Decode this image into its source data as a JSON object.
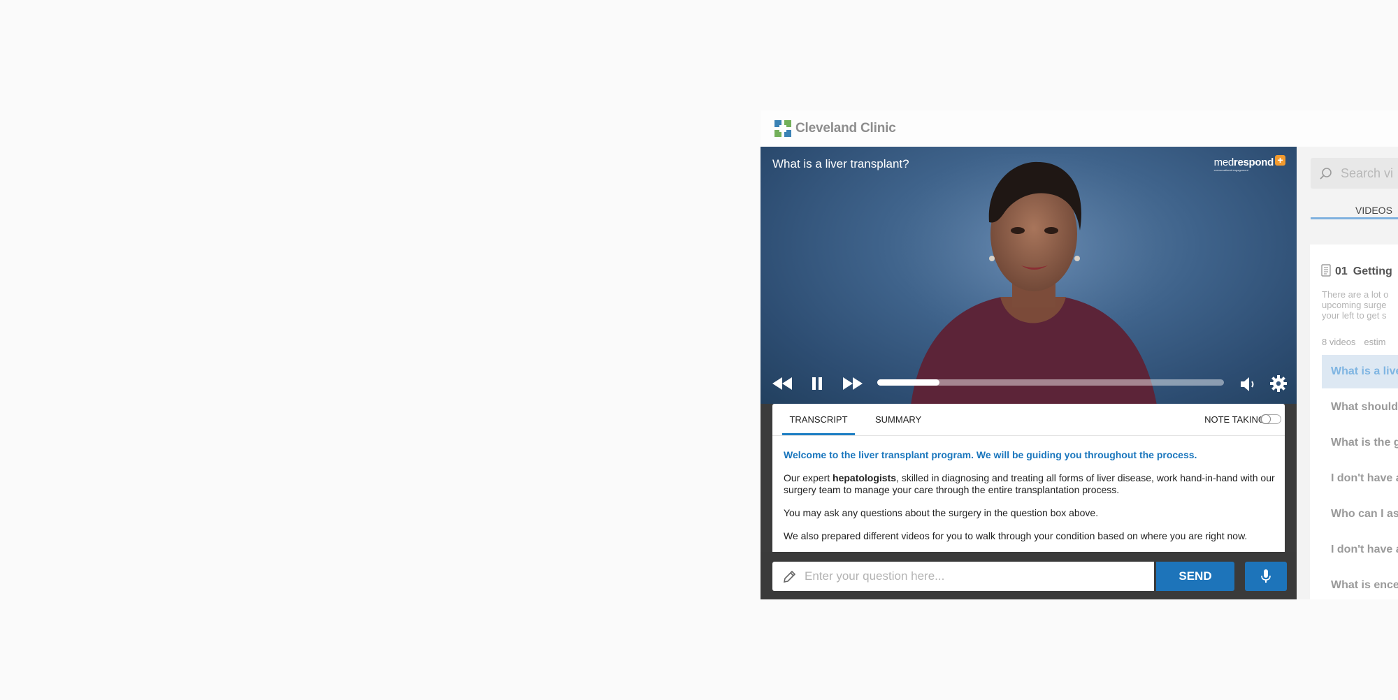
{
  "header": {
    "brand": "Cleveland Clinic"
  },
  "player": {
    "title": "What is a liver transplant?",
    "watermark_prefix": "med",
    "watermark_suffix": "respond",
    "watermark_sub": "conversational engagement",
    "progress_fraction": 0.18
  },
  "transcript_panel": {
    "tabs": [
      "TRANSCRIPT",
      "SUMMARY"
    ],
    "active_tab": "TRANSCRIPT",
    "note_taking_label": "NOTE TAKING",
    "note_taking_on": false,
    "lead": "Welcome to the liver transplant program. We will be guiding you throughout the process.",
    "p1_before": "Our expert ",
    "p1_bold": "hepatologists",
    "p1_after": ", skilled in diagnosing and treating all forms of liver disease, work hand-in-hand with our surgery team to manage your care through the entire transplantation process.",
    "p2": "You may ask any questions about the surgery in the question box above.",
    "p3": "We also prepared different videos for you to walk through your condition based on where you are right now."
  },
  "question": {
    "placeholder": "Enter your question here...",
    "value": "",
    "send_label": "SEND"
  },
  "sidebar": {
    "search_placeholder": "Search vi",
    "tab_label": "VIDEOS",
    "section_number": "01",
    "section_title": "Getting",
    "description_lines": [
      "There are a lot o",
      "upcoming surge",
      "your left to get s"
    ],
    "video_count": "8 videos",
    "estimate_label": "estim",
    "videos": [
      "What is a live",
      "What should",
      "What is the g",
      "I don't have a",
      "Who can I as",
      "I don't have a",
      "What is ence"
    ]
  },
  "colors": {
    "accent": "#1d74ba",
    "active_item_bg": "#dde8f3",
    "active_item_text": "#7fb5e2",
    "lead_text": "#1a76bd"
  },
  "icons": [
    "cleveland-logo-icon",
    "rewind-icon",
    "pause-icon",
    "fast-forward-icon",
    "volume-icon",
    "settings-gear-icon",
    "pencil-icon",
    "microphone-icon",
    "search-icon",
    "document-icon"
  ]
}
